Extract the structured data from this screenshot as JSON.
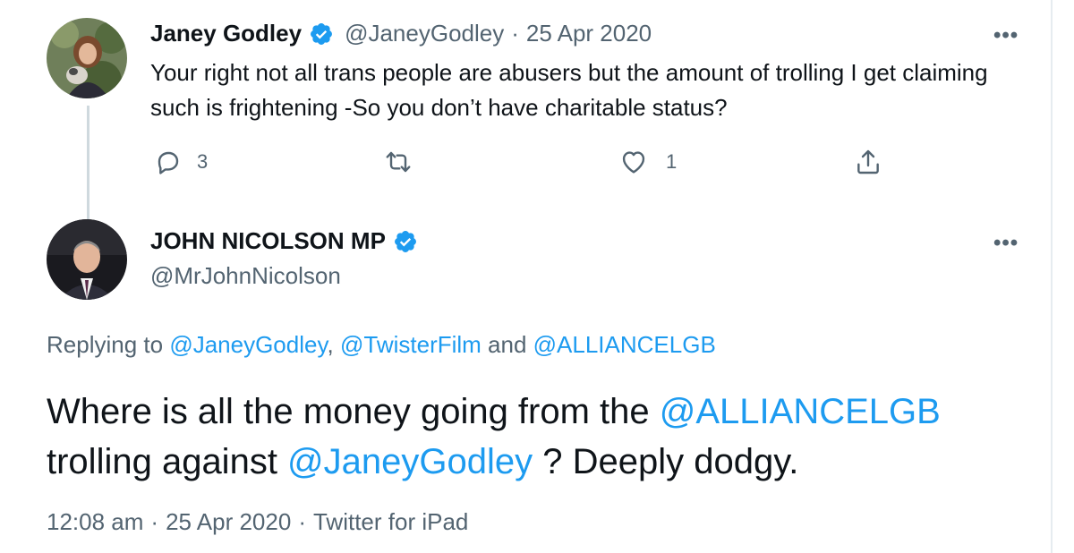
{
  "colors": {
    "link": "#1d9bf0",
    "secondary_text": "#536471",
    "primary_text": "#0f1419",
    "verified_badge": "#1d9bf0",
    "thread_line": "#cfd9de"
  },
  "reply_tweet": {
    "display_name": "Janey Godley",
    "verified": true,
    "handle": "@JaneyGodley",
    "separator": "·",
    "date": "25 Apr 2020",
    "more_icon": "more-horizontal-icon",
    "text": "Your right not all trans people are abusers but the amount of trolling I get claiming such is frightening -So you don’t have charitable status?",
    "actions": {
      "reply_count": "3",
      "retweet_count": "",
      "like_count": "1"
    }
  },
  "main_tweet": {
    "display_name": "JOHN NICOLSON MP",
    "verified": true,
    "handle": "@MrJohnNicolson",
    "more_icon": "more-horizontal-icon",
    "replying_prefix": "Replying to ",
    "replying_to": [
      "@JaneyGodley",
      "@TwisterFilm",
      "@ALLIANCELGB"
    ],
    "replying_sep_1": ", ",
    "replying_sep_2": " and ",
    "text_part_1": "Where is all the money going from the ",
    "text_mention_1": "@ALLIANCELGB",
    "text_part_2": " trolling against ",
    "text_mention_2": "@JaneyGodley",
    "text_part_3": " ? Deeply dodgy.",
    "time": "12:08 am",
    "date": "25 Apr 2020",
    "source": "Twitter for iPad",
    "separator": "·"
  }
}
